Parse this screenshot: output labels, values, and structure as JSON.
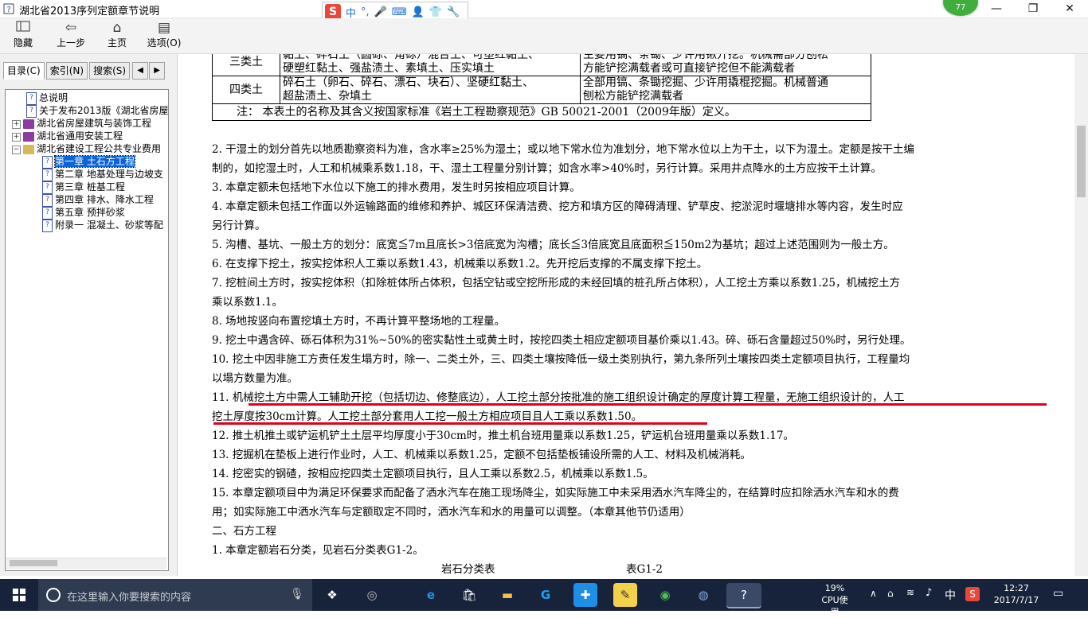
{
  "window": {
    "title": "湖北省2013序列定额章节说明",
    "minimize": "—",
    "maximize": "❐",
    "close": "✕"
  },
  "ime": {
    "logo": "S",
    "lang": "中",
    "punct": "°,",
    "mic": "🎤",
    "keyboard": "⌨",
    "user": "👤",
    "shirt": "👕",
    "tools": "🔧"
  },
  "badge": "77",
  "toolbar": {
    "hide": "隐藏",
    "back": "上一步",
    "home": "主页",
    "options": "选项(O)"
  },
  "tabs": [
    "目录(C)",
    "索引(N)",
    "搜索(S)"
  ],
  "tab_prev": "◀",
  "tab_next": "▶",
  "tree": [
    {
      "label": "总说明",
      "icon": "page"
    },
    {
      "label": "关于发布2013版《湖北省房屋",
      "icon": "page"
    },
    {
      "label": "湖北省房屋建筑与装饰工程",
      "icon": "book",
      "exp": "+"
    },
    {
      "label": "湖北省通用安装工程",
      "icon": "book",
      "exp": "+"
    },
    {
      "label": "湖北省建设工程公共专业费用",
      "icon": "book-open",
      "exp": "−"
    },
    {
      "label": "第一章 土石方工程",
      "icon": "page",
      "selected": true
    },
    {
      "label": "第二章 地基处理与边坡支",
      "icon": "page"
    },
    {
      "label": "第三章 桩基工程",
      "icon": "page"
    },
    {
      "label": "第四章 排水、降水工程",
      "icon": "page"
    },
    {
      "label": "第五章 预拌砂浆",
      "icon": "page"
    },
    {
      "label": "附录一 混凝土、砂浆等配",
      "icon": "page"
    }
  ],
  "soil_table": {
    "rows": [
      {
        "cls": "三类土",
        "desc1": "黏土、碎石土（圆砾、角砾）混合土、可塑红黏土、",
        "desc2": "硬塑红黏土、强盐渍土、素填土、压实填土",
        "tool1": "主要用镐、条锄、少许用锹开挖。机械需部分刨松",
        "tool2": "方能铲挖满载者或可直接铲挖但不能满载者"
      },
      {
        "cls": "四类土",
        "desc1": "碎石土（卵石、碎石、漂石、块石）、坚硬红黏土、",
        "desc2": "超盐渍土、杂填土",
        "tool1": "全部用镐、条锄挖掘、少许用撬棍挖掘。机械普通",
        "tool2": "刨松方能铲挖满载者"
      }
    ],
    "note": "注：   本表土的名称及其含义按国家标准《岩土工程勘察规范》GB 50021-2001（2009年版）定义。"
  },
  "paragraphs": [
    "2. 干湿土的划分首先以地质勘察资料为准，含水率≥25%为湿土；或以地下常水位为准划分，地下常水位以上为干土，以下为湿土。定额是按干土编",
    "制的，如挖湿土时，人工和机械乘系数1.18，干、湿土工程量分别计算；如含水率>40%时，另行计算。采用井点降水的土方应按干土计算。",
    "3. 本章定额未包括地下水位以下施工的排水费用，发生时另按相应项目计算。",
    "4. 本章定额未包括工作面以外运输路面的维修和养护、城区环保清洁费、挖方和填方区的障碍清理、铲草皮、挖淤泥时堰塘排水等内容，发生时应",
    "另行计算。",
    "5. 沟槽、基坑、一般土方的划分：底宽≦7m且底长>3倍底宽为沟槽；底长≦3倍底宽且底面积≦150m2为基坑；超过上述范围则为一般土方。",
    "6. 在支撑下挖土，按实挖体积人工乘以系数1.43，机械乘以系数1.2。先开挖后支撑的不属支撑下挖土。",
    "7. 挖桩间土方时，按实挖体积（扣除桩体所占体积，包括空钻或空挖所形成的未经回填的桩孔所占体积），人工挖土方乘以系数1.25，机械挖土方",
    "乘以系数1.1。",
    "8. 场地按竖向布置挖填土方时，不再计算平整场地的工程量。",
    "9. 挖土中遇含碎、砾石体积为31%~50%的密实黏性土或黄土时，按挖四类土相应定额项目基价乘以1.43。碎、砾石含量超过50%时，另行处理。",
    "10. 挖土中因非施工方责任发生塌方时，除一、二类土外，三、四类土壤按降低一级土类别执行，第九条所列土壤按四类土定额项目执行，工程量均",
    "以塌方数量为准。",
    "11. 机械挖土方中需人工辅助开挖（包括切边、修整底边），人工挖土部分按批准的施工组织设计确定的厚度计算工程量，无施工组织设计的，人工",
    "挖土厚度按30cm计算。人工挖土部分套用人工挖一般土方相应项目且人工乘以系数1.50。",
    "12. 推土机推土或铲运机铲土土层平均厚度小于30cm时，推土机台班用量乘以系数1.25，铲运机台班用量乘以系数1.17。",
    "13. 挖掘机在垫板上进行作业时，人工、机械乘以系数1.25，定额不包括垫板铺设所需的人工、材料及机械消耗。",
    "14. 挖密实的钢碴，按相应挖四类土定额项目执行，且人工乘以系数2.5，机械乘以系数1.5。",
    "15. 本章定额项目中为满足环保要求而配备了洒水汽车在施工现场降尘，如实际施工中未采用洒水汽车降尘的，在结算时应扣除洒水汽车和水的费",
    "用；如实际施工中洒水汽车与定额取定不同时，洒水汽车和水的用量可以调整。（本章其他节仍适用）",
    "二、石方工程",
    "1. 本章定额岩石分类，见岩石分类表G1-2。"
  ],
  "table_caption": {
    "title": "岩石分类表",
    "code": "表G1-2"
  },
  "taskbar": {
    "search_placeholder": "在这里输入你要搜索的内容",
    "cpu_percent": "19%",
    "cpu_label": "CPU使用",
    "ime_lang": "中",
    "time": "12:27",
    "date": "2017/7/17"
  },
  "colors": {
    "taskbar": "#16233a",
    "selection": "#0a64d8",
    "annotation": "#e0001b"
  }
}
